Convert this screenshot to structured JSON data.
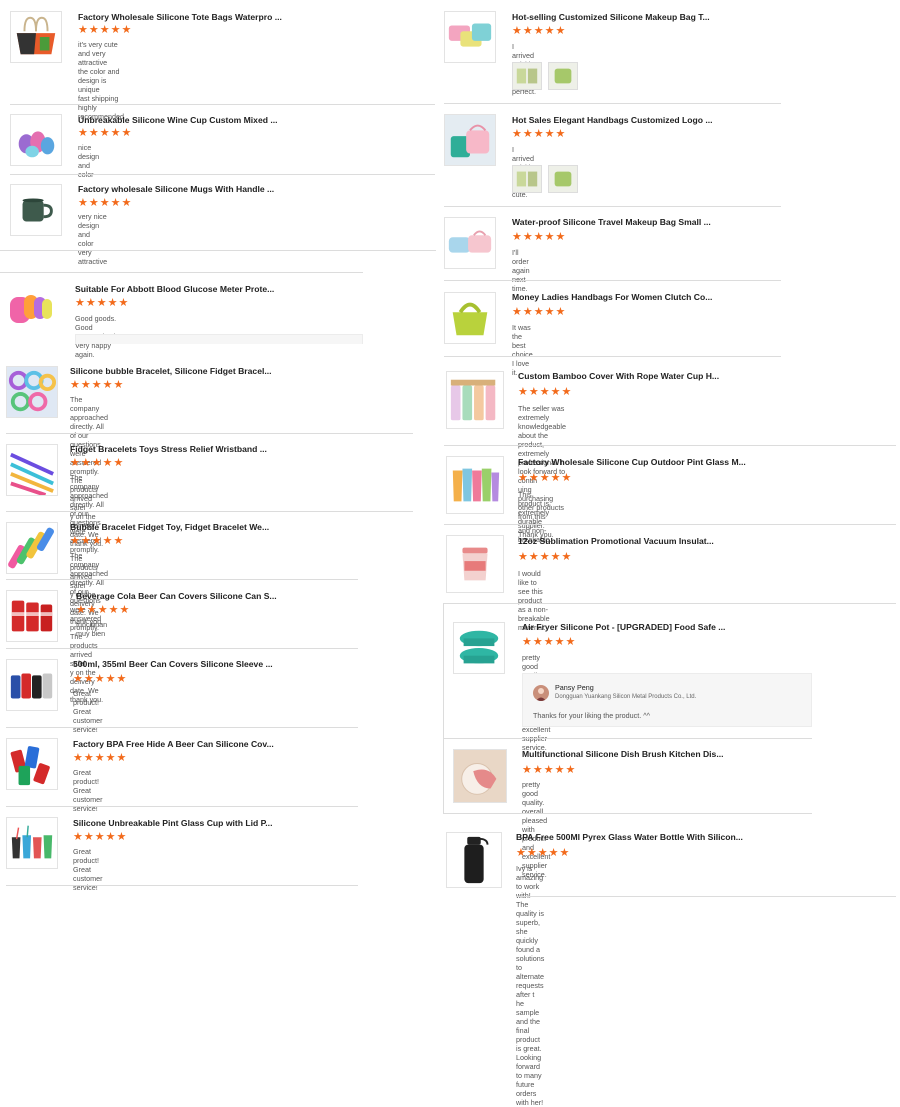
{
  "reviews_left": [
    {
      "title": "Factory Wholesale Silicone Tote Bags Waterpro ...",
      "stars": "★★★★★",
      "review": "it's very cute and very\nattractive\nthe color and design is unique\nfast shipping\nhighly recommended",
      "icon": "tote-bag-icon"
    },
    {
      "title": "Unbreakable Silicone Wine Cup Custom Mixed ...",
      "stars": "★★★★★",
      "review": "nice design and color",
      "icon": "wine-cup-icon"
    },
    {
      "title": "Factory wholesale Silicone Mugs With Handle ...",
      "stars": "★★★★★",
      "review": "very nice design and color\nvery attractive",
      "icon": "mug-icon"
    },
    {
      "title": "Suitable For Abbott Blood Glucose Meter Prote...",
      "stars": "★★★★★",
      "review": "Good goods. Good communication. Very happy again.",
      "icon": "glucose-cover-icon"
    },
    {
      "title": "Silicone bubble Bracelet, Silicone Fidget Bracel...",
      "stars": "★★★★★",
      "review": "The company approached directly. All of our questions were answered promptly. The products arrived safel\ny on the delivery date. We thank you.",
      "icon": "bubble-bracelet-icon"
    },
    {
      "title": "Fidget Bracelets Toys Stress Relief Wristband ...",
      "stars": "★★★★★",
      "review": "The company approached directly. All of our questions were answered promptly. The products arrived safel\ny on the delivery date. We thank you.",
      "icon": "wristband-icon"
    },
    {
      "title": "Bubble Bracelet Fidget Toy, Fidget Bracelet We...",
      "stars": "★★★★★",
      "review": "The company approached directly. All of our questions were answered promptly. The products arrived safel\ny on the delivery date. We thank you.",
      "icon": "fidget-bracelet-icon"
    },
    {
      "title": "Beverage Cola Beer Can Covers Silicone Can S...",
      "stars": "★★★★★",
      "review": "funcionan muy bien",
      "icon": "cola-can-icon"
    },
    {
      "title": "500ml, 355ml Beer Can Covers Silicone Sleeve ...",
      "stars": "★★★★★",
      "review": "Great product!\nGreat customer service!",
      "icon": "beer-can-icon"
    },
    {
      "title": "Factory BPA Free Hide A Beer Can Silicone Cov...",
      "stars": "★★★★★",
      "review": "Great product!\nGreat customer service!",
      "icon": "can-cover-icon"
    },
    {
      "title": "Silicone Unbreakable Pint Glass Cup with Lid P...",
      "stars": "★★★★★",
      "review": "Great product!\nGreat customer service!",
      "icon": "pint-glass-icon"
    }
  ],
  "reviews_right": [
    {
      "title": "Hot-selling Customized Silicone Makeup Bag T...",
      "stars": "★★★★★",
      "review": "I arrived quickly and it was perfect.",
      "icon": "makeup-bag-icon"
    },
    {
      "title": "Hot Sales Elegant Handbags Customized Logo ...",
      "stars": "★★★★★",
      "review": "I arrived quickly and it's so cute.",
      "icon": "handbag-icon"
    },
    {
      "title": "Water-proof Silicone Travel Makeup Bag Small ...",
      "stars": "★★★★★",
      "review": "I'll order again next time.",
      "icon": "travel-bag-icon"
    },
    {
      "title": "Money Ladies Handbags For Women Clutch Co...",
      "stars": "★★★★★",
      "review": "It was the best choice. I love it.",
      "icon": "clutch-icon"
    },
    {
      "title": "Custom Bamboo Cover With Rope Water Cup H...",
      "stars": "★★★★★",
      "review": "The seller was extremely knowledgeable about the product, extremely professional. I look forward to contin\nuing purchasing other products from this supplier. Thank you.",
      "icon": "bamboo-cup-icon"
    },
    {
      "title": "Factory Wholesale Silicone Cup Outdoor Pint Glass M...",
      "stars": "★★★★★",
      "review": "This product is extremely durable and non-breakable.",
      "icon": "outdoor-cup-icon"
    },
    {
      "title": "12oz Sublimation Promotional Vacuum Insulat...",
      "stars": "★★★★★",
      "review": "I would like to see this product as a non-breakable material.",
      "icon": "vacuum-cup-icon"
    },
    {
      "title": "Air Fryer Silicone Pot - [UPGRADED] Food Safe ...",
      "stars": "★★★★★",
      "review": "pretty good quality. overall pleased with product and excellent supplier service.",
      "icon": "air-fryer-pot-icon"
    },
    {
      "title": "Multifunctional Silicone Dish Brush Kitchen Dis...",
      "stars": "★★★★★",
      "review": "pretty good quality. overall pleased with product and excellent supplier service.",
      "icon": "dish-brush-icon"
    },
    {
      "title": "BPA Free 500Ml Pyrex Glass Water Bottle With Silicon...",
      "stars": "★★★★★",
      "review": "Ivy is amazing to work with! The quality is superb, she quickly found a solutions to alternate requests after t\nhe sample and the final product is great. Looking forward to many future orders with her!",
      "icon": "water-bottle-icon"
    }
  ],
  "reply": {
    "name": "Pansy Peng",
    "company": "Dongguan Yuankang Silicon Metal Products Co., Ltd.",
    "text": "Thanks for your liking the product. ^^"
  },
  "colors": {
    "stars": "#f26a1b",
    "separator": "#dcdcdc"
  }
}
